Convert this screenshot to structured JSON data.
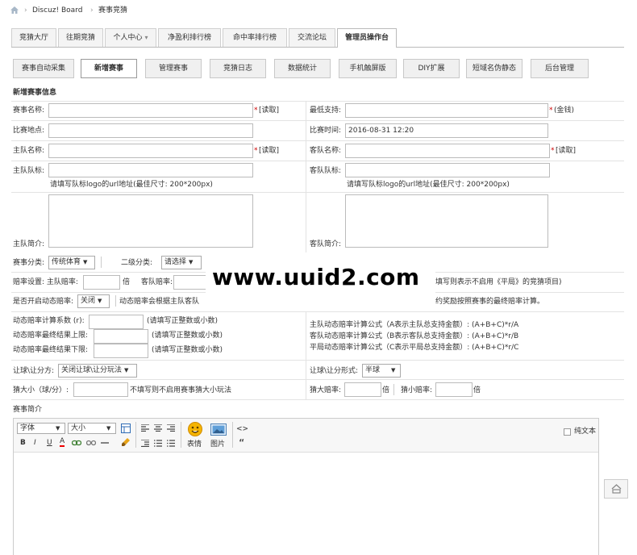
{
  "breadcrumb": {
    "home_icon": "home-icon",
    "sep": "›",
    "site": "Discuz! Board",
    "current": "赛事竞猜"
  },
  "tabs": [
    "竞猜大厅",
    "往期竞猜",
    "个人中心",
    "净盈利排行榜",
    "命中率排行榜",
    "交流论坛",
    "管理员操作台"
  ],
  "tab_dropdown_mark": "▾",
  "subtabs": [
    "赛事自动采集",
    "新增赛事",
    "管理赛事",
    "竞猜日志",
    "数据统计",
    "手机触屏版",
    "DIY扩展",
    "短域名伪静态",
    "后台管理"
  ],
  "form": {
    "section_title": "新增赛事信息",
    "event_name": "赛事名称:",
    "required_mark": "*",
    "fetch": "[读取]",
    "min_bet": "最低支持:",
    "gold": "(金钱)",
    "venue": "比赛地点:",
    "match_time": "比赛时间:",
    "match_time_value": "2016-08-31 12:20",
    "home_name": "主队名称:",
    "away_name": "客队名称:",
    "home_logo": "主队队标:",
    "away_logo": "客队队标:",
    "logo_hint": "请填写队标logo的url地址(最佳尺寸: 200*200px)",
    "home_intro": "主队简介:",
    "away_intro": "客队简介:",
    "category": "赛事分类:",
    "category_value": "传统体育",
    "subcategory": "二级分类:",
    "subcategory_value": "请选择",
    "odds_setting": "赔率设置: 主队赔率:",
    "odds_unit": "倍",
    "away_odds": "客队赔率:",
    "draw_hint": "填写则表示不启用《平局》的竞猜项目)",
    "dynamic_odds": "是否开启动态赔率:",
    "dynamic_odds_value": "关闭",
    "dynamic_hint_left": "动态赔率会根据主队客队",
    "dynamic_hint_right": "约奖励按照赛事的最终赔率计算。",
    "coef": "动态赔率计算系数 (r):",
    "coef_hint": "(请填写正整数或小数)",
    "upper": "动态赔率最终结果上限:",
    "lower": "动态赔率最终结果下限:",
    "num_hint": "(请填写正整数或小数)",
    "formula_home": "主队动态赔率计算公式（A表示主队总支持金额）: (A+B+C)*r/A",
    "formula_away": "客队动态赔率计算公式（B表示客队总支持金额）: (A+B+C)*r/B",
    "formula_draw": "平局动态赔率计算公式（C表示平局总支持金额）: (A+B+C)*r/C",
    "handicap_mode": "让球\\让分方: ",
    "handicap_mode_value": "关闭让球\\让分玩法",
    "handicap_type": "让球\\让分形式:",
    "handicap_type_value": "半球",
    "size": "猜大小（球/分）:",
    "size_hint": "不填写则不启用赛事猜大小玩法",
    "big_odds": "猜大赔率:",
    "small_odds": "猜小赔率:",
    "editor_label": "赛事简介"
  },
  "editor": {
    "font_select": "字体",
    "size_select": "大小",
    "emoticon": "表情",
    "image": "图片",
    "plain_text": "纯文本",
    "bold": "B",
    "italic": "I",
    "underline": "U",
    "font_color": "A",
    "quote": "“",
    "code": "<>"
  },
  "watermark": "www.uuid2.com",
  "colors": {
    "watermark": "#000000",
    "required": "#cc0000"
  }
}
